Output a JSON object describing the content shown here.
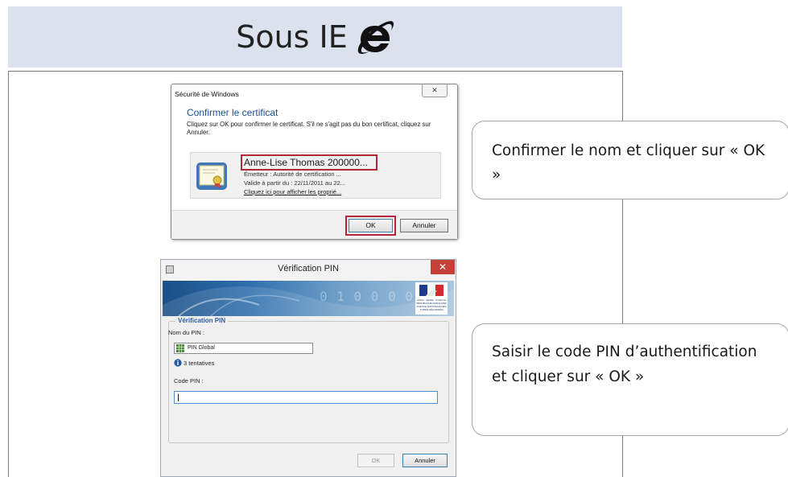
{
  "banner": {
    "title": "Sous IE",
    "icon": "internet-explorer-icon"
  },
  "colors": {
    "banner_bg": "#dbe2ee",
    "highlight_red": "#b3273b",
    "link_blue": "#1a4e93"
  },
  "security_dialog": {
    "caption": "Sécurité de Windows",
    "close_glyph": "✕",
    "heading": "Confirmer le certificat",
    "description": "Cliquez sur OK pour confirmer le certificat. S'il ne s'agit pas du bon certificat, cliquez sur Annuler.",
    "certificate": {
      "icon": "certificate-icon",
      "name": "Anne-Lise Thomas 200000...",
      "issuer": "Émetteur : Autorité de certification ...",
      "validity": "Valide à partir du : 22/11/2011 au 22...",
      "properties_link": "Cliquez ici pour afficher les proprié..."
    },
    "ok_label": "OK",
    "cancel_label": "Annuler"
  },
  "callouts": {
    "confirm": "Confirmer le nom et cliquer sur « OK »",
    "pin": "Saisir le code PIN d’authentification et cliquer sur « OK »"
  },
  "pin_dialog": {
    "title": "Vérification PIN",
    "close_glyph": "✕",
    "banner_digits": "0 1 0 0 0 0 0",
    "logo_text": "Liberté · Égalité · Fraternité RÉPUBLIQUE FRANÇAISE AGENCE NATIONALE DES TITRES SÉCURISÉS",
    "group_title": "Vérification PIN",
    "pin_name_label": "Nom du PIN :",
    "pin_name_value": "PIN Global",
    "attempts": "3 tentatives",
    "pin_code_label": "Code PIN :",
    "pin_code_value": "",
    "ok_label": "OK",
    "cancel_label": "Annuler"
  }
}
